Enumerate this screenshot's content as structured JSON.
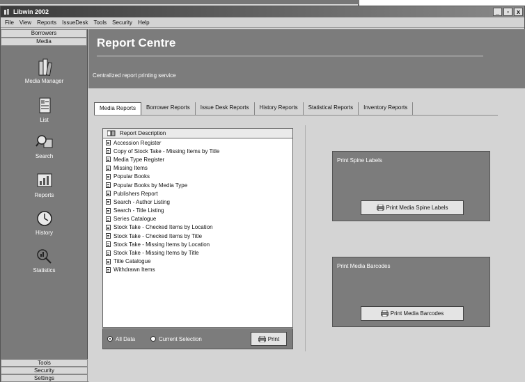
{
  "window": {
    "title": "Libwin 2002"
  },
  "menu": [
    "File",
    "View",
    "Reports",
    "IssueDesk",
    "Tools",
    "Security",
    "Help"
  ],
  "sidebar": {
    "top_groups": [
      "Borrowers",
      "Media"
    ],
    "items": [
      {
        "label": "Media Manager",
        "icon": "books-icon"
      },
      {
        "label": "List",
        "icon": "list-icon"
      },
      {
        "label": "Search",
        "icon": "search-icon"
      },
      {
        "label": "Reports",
        "icon": "reports-icon"
      },
      {
        "label": "History",
        "icon": "history-icon"
      },
      {
        "label": "Statistics",
        "icon": "statistics-icon"
      }
    ],
    "bottom_groups": [
      "Tools",
      "Security",
      "Settings"
    ]
  },
  "header": {
    "title": "Report Centre",
    "subtitle": "Centralized report printing service"
  },
  "tabs": [
    {
      "label": "Media Reports",
      "active": true
    },
    {
      "label": "Borrower Reports",
      "active": false
    },
    {
      "label": "Issue Desk Reports",
      "active": false
    },
    {
      "label": "History Reports",
      "active": false
    },
    {
      "label": "Statistical Reports",
      "active": false
    },
    {
      "label": "Inventory Reports",
      "active": false
    }
  ],
  "report_list": {
    "column_header": "Report Description",
    "items": [
      "Accession Register",
      "Copy of Stock Take - Missing Items by Title",
      "Media Type Register",
      "Missing Items",
      "Popular Books",
      "Popular Books by Media Type",
      "Publishers Report",
      "Search - Author Listing",
      "Search - Title Listing",
      "Series Catalogue",
      "Stock Take - Checked Items by Location",
      "Stock Take - Checked Items by Title",
      "Stock Take - Missing Items by Location",
      "Stock Take - Missing Items by Title",
      "Title Catalogue",
      "Withdrawn Items"
    ]
  },
  "footer": {
    "option_all": "All Data",
    "option_current": "Current Selection",
    "selected": "All Data",
    "print_label": "Print"
  },
  "spine_panel": {
    "title": "Print Spine Labels",
    "button": "Print Media Spine Labels"
  },
  "barcode_panel": {
    "title": "Print Media Barcodes",
    "button": "Print Media Barcodes"
  },
  "colors": {
    "panel_gray": "#7c7c7c",
    "background": "#d4d4d4"
  }
}
